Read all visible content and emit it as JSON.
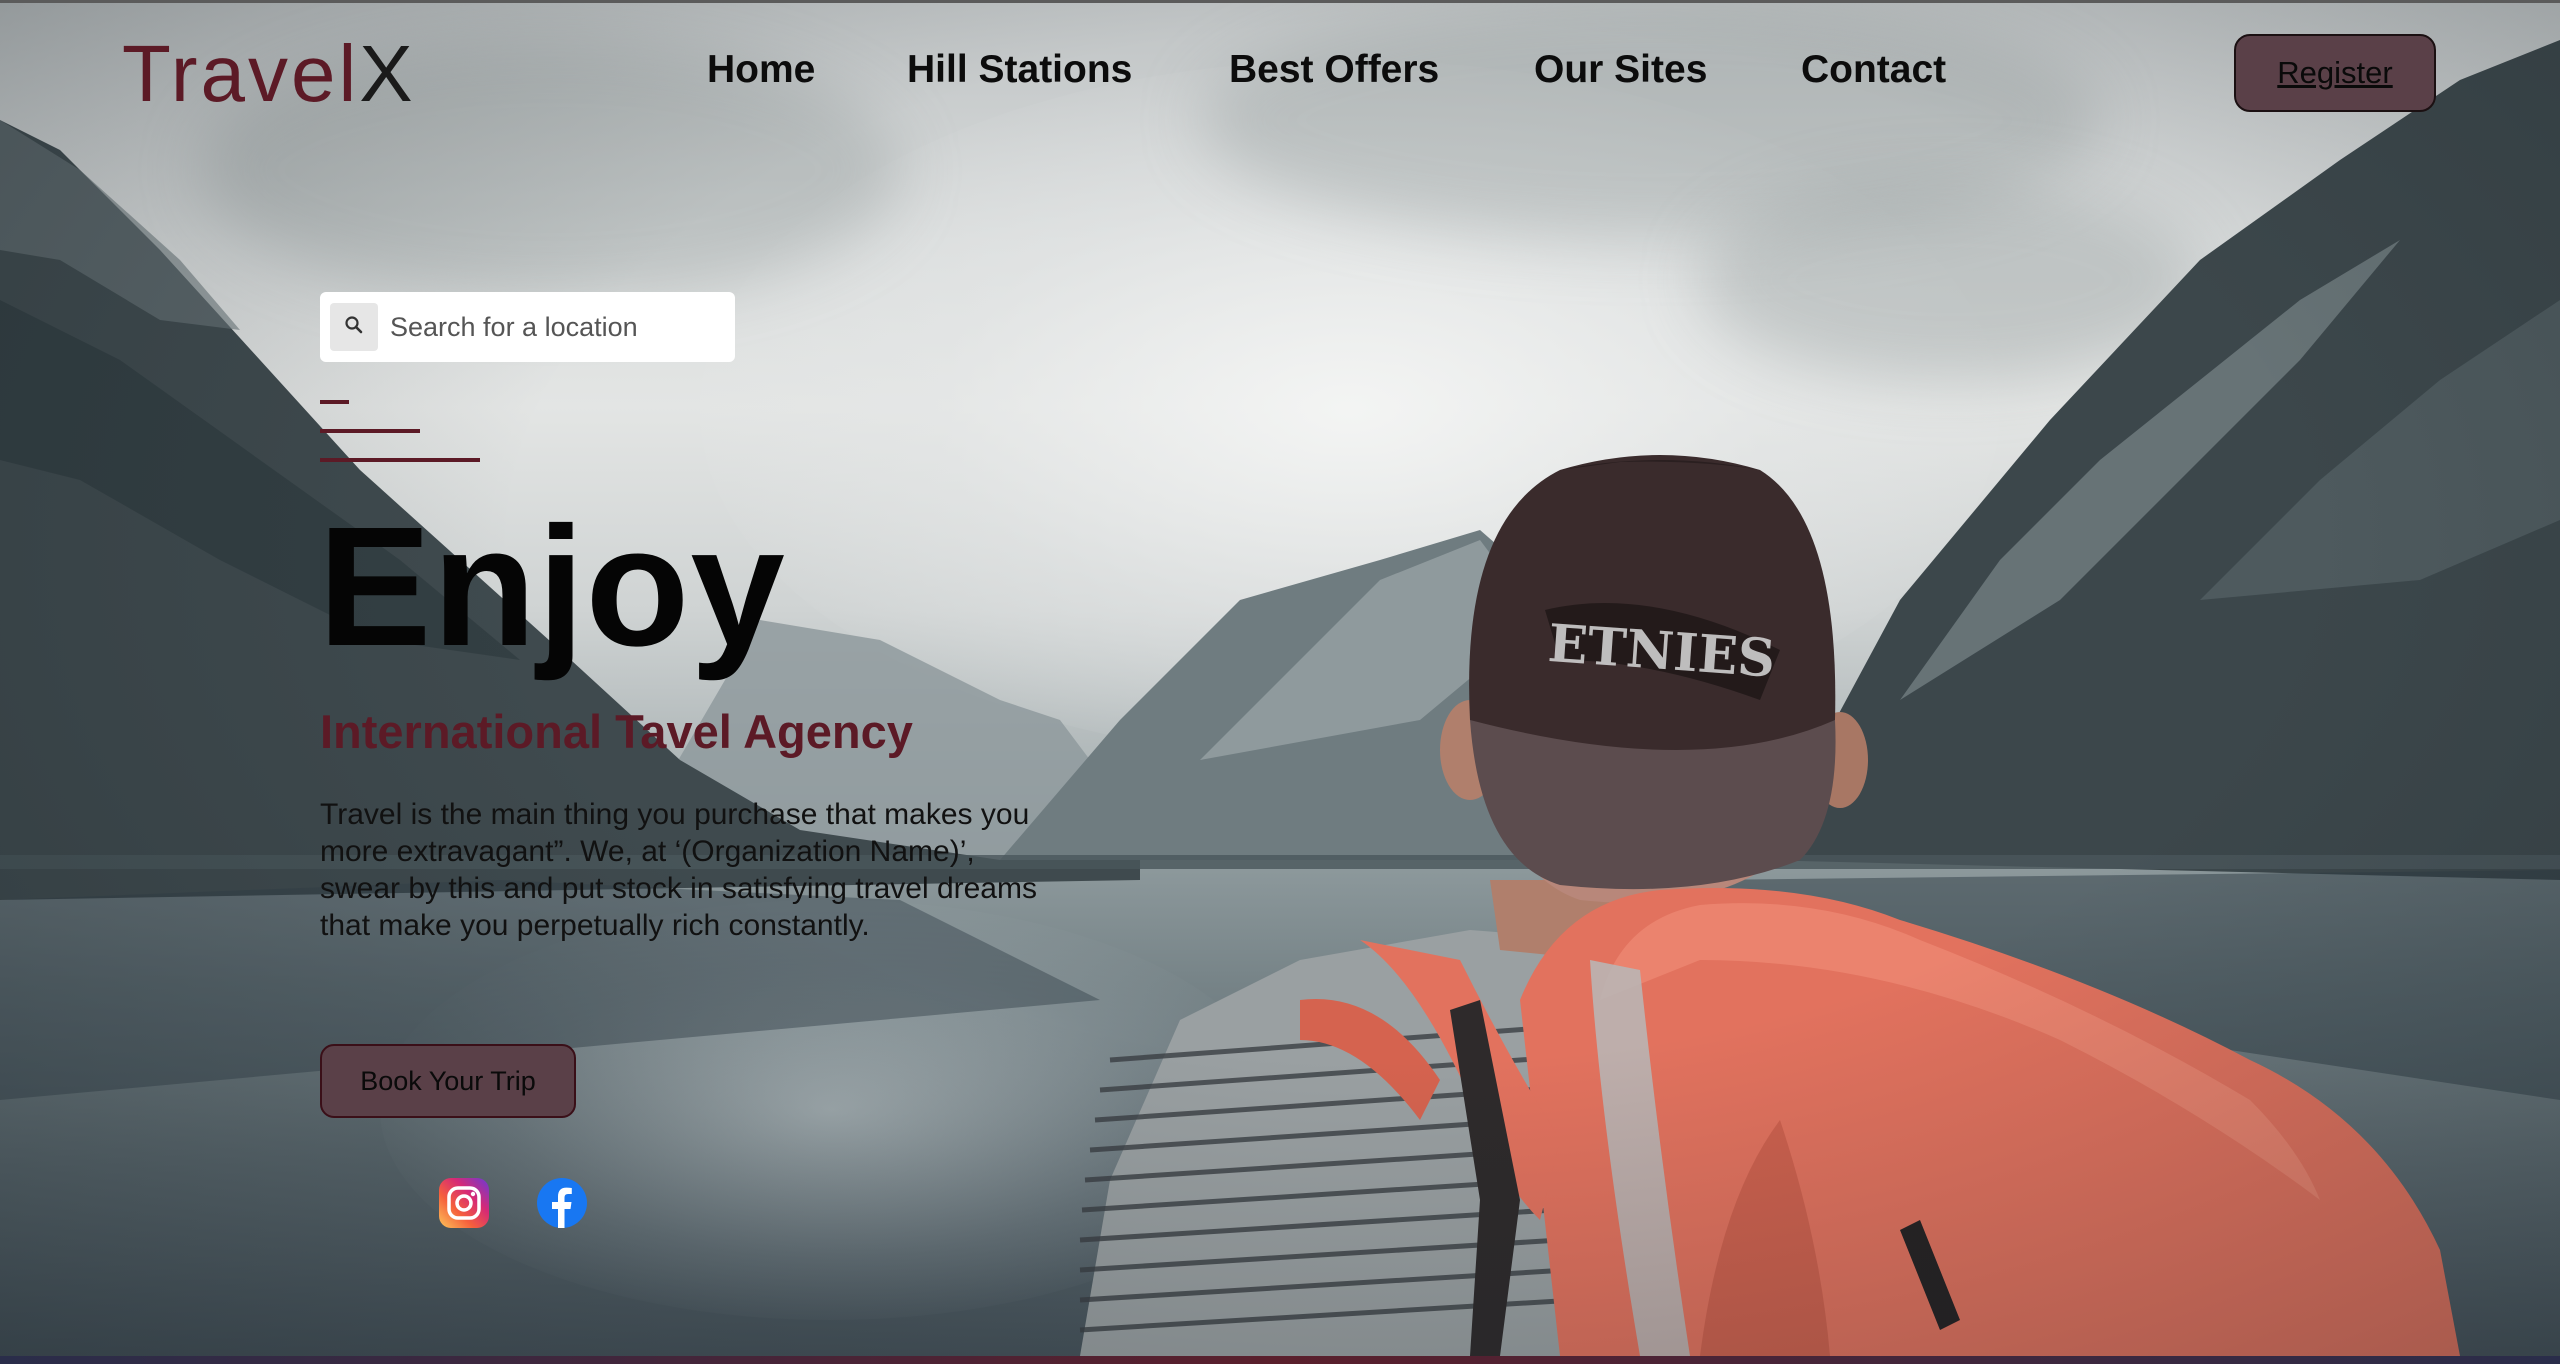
{
  "brand": {
    "part1": "Travel",
    "part2": "X"
  },
  "nav": {
    "items": [
      {
        "label": "Home"
      },
      {
        "label": "Hill Stations"
      },
      {
        "label": "Best Offers"
      },
      {
        "label": "Our Sites"
      },
      {
        "label": "Contact"
      }
    ],
    "register_label": "Register"
  },
  "search": {
    "placeholder": "Search for a location",
    "icon": "search-icon"
  },
  "hero": {
    "title": "Enjoy",
    "subtitle": "International Tavel Agency",
    "description": "Travel is the main thing you purchase that makes you more extravagant”. We, at ‘(Organization Name)’, swear by this and put stock in satisfying travel dreams that make you perpetually rich constantly.",
    "cta_label": "Book Your Trip"
  },
  "social": [
    {
      "name": "instagram-icon"
    },
    {
      "name": "facebook-icon"
    }
  ],
  "colors": {
    "brand_maroon": "#5c1a26",
    "button_bg": "#5a4048",
    "facebook_blue": "#1877f2"
  }
}
